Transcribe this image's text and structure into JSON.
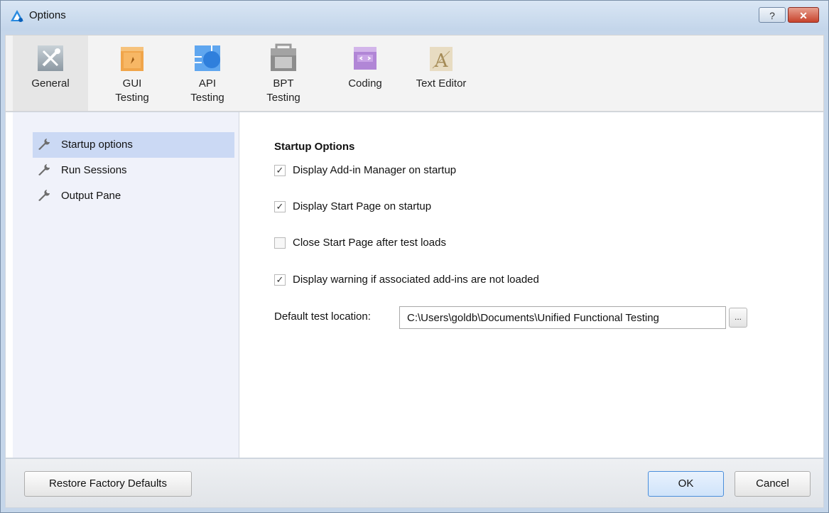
{
  "window": {
    "title": "Options",
    "help_label": "?",
    "close_label": "✕"
  },
  "toolbar": {
    "items": [
      {
        "label": "General",
        "icon": "general-tools-icon",
        "active": true
      },
      {
        "label": "GUI\nTesting",
        "icon": "gui-testing-icon",
        "active": false
      },
      {
        "label": "API\nTesting",
        "icon": "api-testing-icon",
        "active": false
      },
      {
        "label": "BPT\nTesting",
        "icon": "bpt-testing-icon",
        "active": false
      },
      {
        "label": "Coding",
        "icon": "coding-icon",
        "active": false
      },
      {
        "label": "Text Editor",
        "icon": "text-editor-icon",
        "active": false
      }
    ]
  },
  "sidebar": {
    "items": [
      {
        "label": "Startup options",
        "selected": true
      },
      {
        "label": "Run Sessions",
        "selected": false
      },
      {
        "label": "Output Pane",
        "selected": false
      }
    ]
  },
  "main": {
    "section_title": "Startup Options",
    "options": [
      {
        "label": "Display Add-in Manager on startup",
        "checked": true
      },
      {
        "label": "Display Start Page on startup",
        "checked": true
      },
      {
        "label": "Close Start Page after test loads",
        "checked": false
      },
      {
        "label": "Display warning if associated add-ins are not loaded",
        "checked": true
      }
    ],
    "location_label": "Default test location:",
    "location_value": "C:\\Users\\goldb\\Documents\\Unified Functional Testing",
    "browse_label": "..."
  },
  "footer": {
    "restore_label": "Restore Factory Defaults",
    "ok_label": "OK",
    "cancel_label": "Cancel"
  },
  "colors": {
    "title_bar": "#c9d9ec",
    "selected_nav": "#cbd9f4",
    "ok_border": "#4a8edb",
    "close_button": "#c7432c"
  }
}
